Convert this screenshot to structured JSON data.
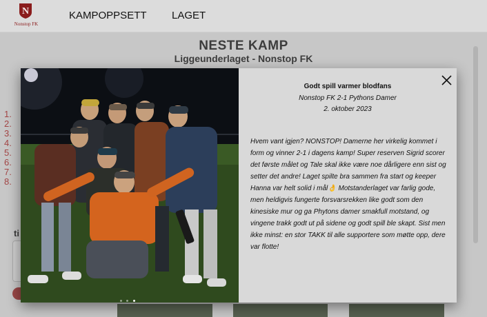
{
  "brand": {
    "logo_letter": "N",
    "name": "Nonstop FK",
    "color": "#8a1c1c"
  },
  "nav": [
    {
      "label": "KAMPOPPSETT"
    },
    {
      "label": "LAGET"
    }
  ],
  "next_match": {
    "heading": "NESTE KAMP",
    "teams": "Liggeunderlaget - Nonstop FK",
    "order_numbers": [
      "1.",
      "2.",
      "3.",
      "4.",
      "5.",
      "6.",
      "7.",
      "8."
    ]
  },
  "modal": {
    "title": "Godt spill varmer blodfans",
    "result": "Nonstop FK 2-1 Pythons Damer",
    "date": "2. oktober 2023",
    "body": "Hvem vant igjen? NONSTOP! Damerne her virkelig kommet i form og vinner 2-1 i dagens kamp! Super reserven Sigrid scorer det første målet og Tale skal ikke være noe dårligere enn sist og setter det andre! Laget spilte bra sammen fra start og keeper Hanna var helt solid i mål👌 Motstanderlaget var farlig gode, men heldigvis fungerte forsvarsrekken like godt som den kinesiske mur og ga Phytons damer smakfull motstand, og vingene trakk godt ut på sidene og godt spill ble skapt. Sist men ikke minst: en stor TAKK til alle supportere som møtte opp, dere var flotte!",
    "close_icon": "close-icon",
    "carousel": {
      "count": 3,
      "active": 3
    }
  }
}
